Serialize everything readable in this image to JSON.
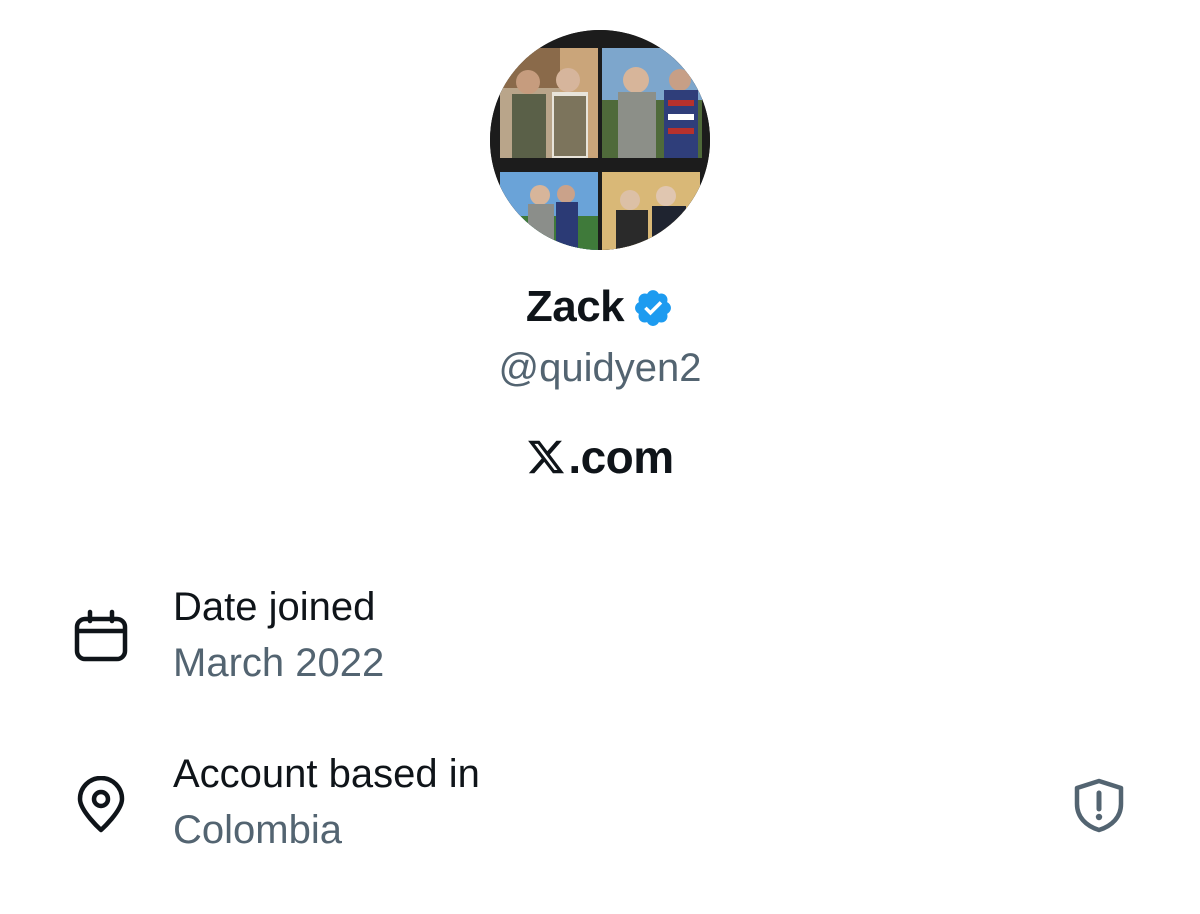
{
  "profile": {
    "display_name": "Zack",
    "handle": "@quidyen2",
    "site": ".com",
    "site_prefix_icon": "x-logo-icon",
    "avatar": "avatar-photo-collage",
    "verified_icon": "verified-badge-icon",
    "colors": {
      "verified": "#1d9bf0",
      "primary_text": "#0f1419",
      "secondary_text": "#536471"
    }
  },
  "about": {
    "date_joined": {
      "icon": "calendar-icon",
      "label": "Date joined",
      "value": "March 2022"
    },
    "account_based_in": {
      "icon": "location-pin-icon",
      "label": "Account based in",
      "value": "Colombia",
      "trailing_icon": "shield-alert-icon"
    }
  }
}
